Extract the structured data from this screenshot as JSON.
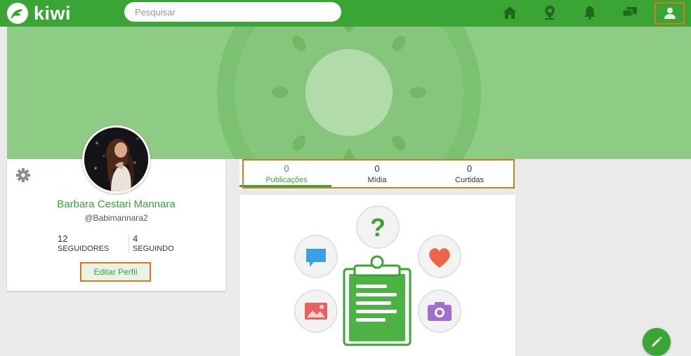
{
  "app": {
    "logo_text": "kiwi"
  },
  "search": {
    "placeholder": "Pesquisar",
    "value": ""
  },
  "nav": {
    "icons": [
      "home-icon",
      "location-pin-icon",
      "bell-icon",
      "chat-icon",
      "user-icon"
    ],
    "active": "user-icon"
  },
  "profile": {
    "name": "Barbara Cestari Mannara",
    "handle": "@Babimannara2",
    "followers_count": "12",
    "followers_label": "SEGUIDORES",
    "following_count": "4",
    "following_label": "SEGUINDO",
    "edit_label": "Editar Perfil"
  },
  "tabs": [
    {
      "count": "0",
      "label": "Publicações",
      "active": true
    },
    {
      "count": "0",
      "label": "Mídia",
      "active": false
    },
    {
      "count": "0",
      "label": "Curtidas",
      "active": false
    }
  ],
  "colors": {
    "brand_green": "#3aa534",
    "cover_green": "#8ecb84",
    "highlight_orange": "#d8781e",
    "heart_red": "#f0644a",
    "chat_blue": "#3aa0e0",
    "camera_purple": "#a070d0",
    "image_red": "#e86060"
  }
}
